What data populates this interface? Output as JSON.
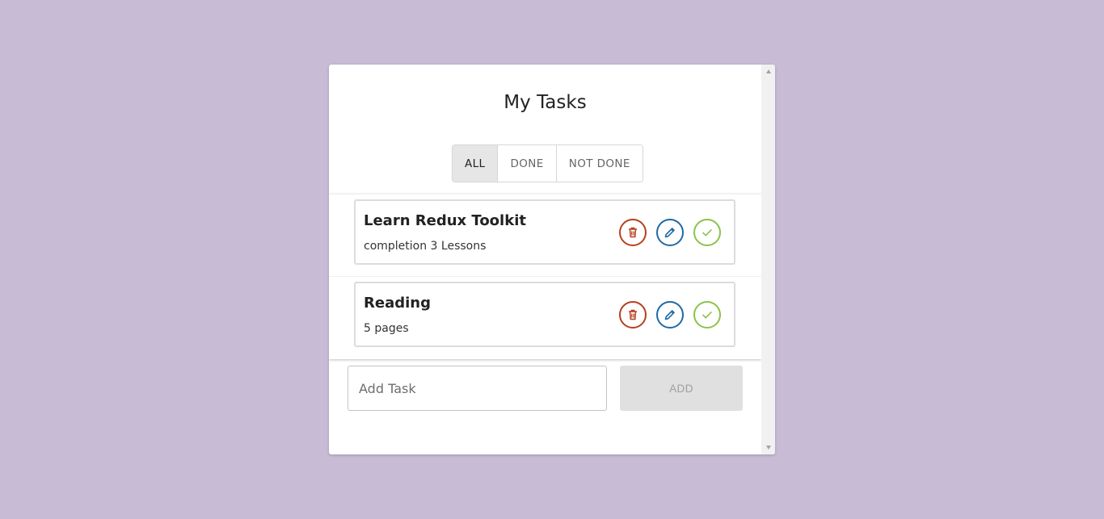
{
  "page": {
    "background_color": "#c8bbd5",
    "title": "My Tasks"
  },
  "filters": {
    "options": [
      "ALL",
      "DONE",
      "NOT DONE"
    ],
    "selected": "ALL"
  },
  "tasks": [
    {
      "title": "Learn Redux Toolkit",
      "description": "completion 3 Lessons"
    },
    {
      "title": "Reading",
      "description": "5 pages"
    }
  ],
  "task_actions": {
    "delete_icon": "trash-icon",
    "edit_icon": "pencil-icon",
    "done_icon": "check-icon",
    "delete_color": "#b5401f",
    "edit_color": "#1e6aa6",
    "done_color": "#8bc34a"
  },
  "add_form": {
    "placeholder": "Add Task",
    "value": "",
    "button_label": "ADD",
    "button_disabled": true
  }
}
